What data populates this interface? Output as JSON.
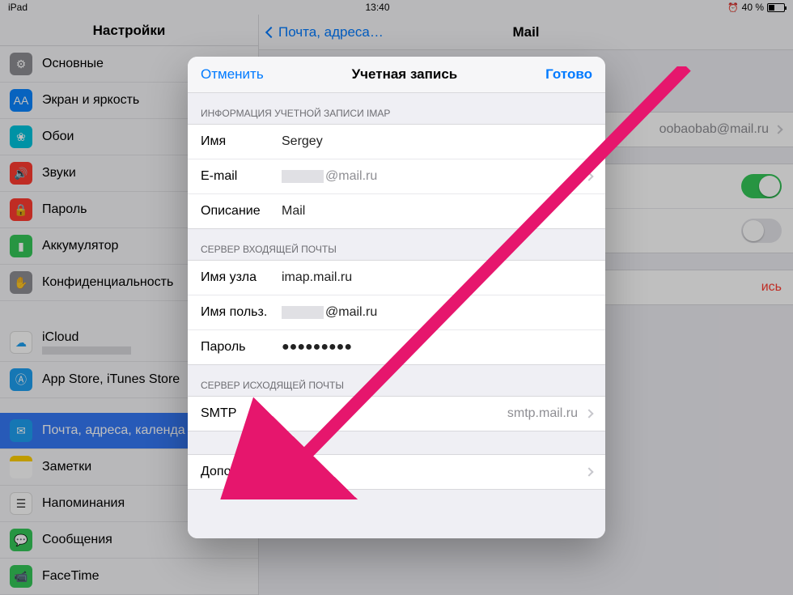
{
  "status": {
    "device": "iPad",
    "time": "13:40",
    "battery_percent": "40 %"
  },
  "sidebar": {
    "title": "Настройки",
    "items": [
      {
        "id": "general",
        "label": "Основные",
        "icon": "gear"
      },
      {
        "id": "display",
        "label": "Экран и яркость",
        "icon": "display"
      },
      {
        "id": "wallpaper",
        "label": "Обои",
        "icon": "wallpaper"
      },
      {
        "id": "sounds",
        "label": "Звуки",
        "icon": "sound"
      },
      {
        "id": "passcode",
        "label": "Пароль",
        "icon": "pass"
      },
      {
        "id": "battery",
        "label": "Аккумулятор",
        "icon": "battery"
      },
      {
        "id": "privacy",
        "label": "Конфиденциальность",
        "icon": "privacy"
      }
    ],
    "group2": [
      {
        "id": "icloud",
        "label": "iCloud",
        "icon": "icloud"
      },
      {
        "id": "appstore",
        "label": "App Store, iTunes Store",
        "icon": "appstore"
      }
    ],
    "group3": [
      {
        "id": "mail",
        "label": "Почта, адреса, календа",
        "icon": "mail",
        "selected": true
      },
      {
        "id": "notes",
        "label": "Заметки",
        "icon": "notes"
      },
      {
        "id": "reminders",
        "label": "Напоминания",
        "icon": "reminders"
      },
      {
        "id": "messages",
        "label": "Сообщения",
        "icon": "messages"
      },
      {
        "id": "facetime",
        "label": "FaceTime",
        "icon": "facetime"
      }
    ]
  },
  "content": {
    "back_label": "Почта, адреса…",
    "title": "Mail",
    "account_email": "oobaobab@mail.ru",
    "delete_partial": "ись"
  },
  "modal": {
    "cancel": "Отменить",
    "done": "Готово",
    "title": "Учетная запись",
    "section_info": "ИНФОРМАЦИЯ УЧЕТНОЙ ЗАПИСИ IMAP",
    "name_key": "Имя",
    "name_val": "Sergey",
    "email_key": "E-mail",
    "email_domain": "@mail.ru",
    "desc_key": "Описание",
    "desc_val": "Mail",
    "section_in": "СЕРВЕР ВХОДЯЩЕЙ ПОЧТЫ",
    "host_key": "Имя узла",
    "host_val": "imap.mail.ru",
    "user_key": "Имя польз.",
    "user_domain": "@mail.ru",
    "pass_key": "Пароль",
    "pass_val": "●●●●●●●●●",
    "section_out": "СЕРВЕР ИСХОДЯЩЕЙ ПОЧТЫ",
    "smtp_key": "SMTP",
    "smtp_val": "smtp.mail.ru",
    "advanced": "Дополнительно"
  }
}
